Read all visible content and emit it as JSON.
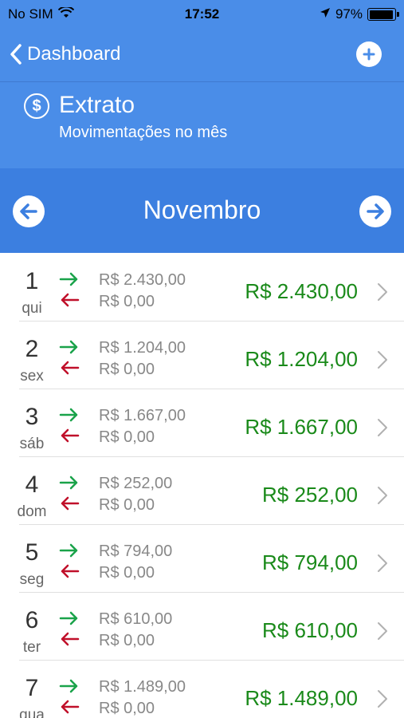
{
  "status_bar": {
    "carrier": "No SIM",
    "time": "17:52",
    "battery_percent": "97%",
    "battery_level": 0.97
  },
  "navbar": {
    "back_label": "Dashboard"
  },
  "header": {
    "title": "Extrato",
    "subtitle": "Movimentações no mês"
  },
  "month_selector": {
    "month": "Novembro"
  },
  "colors": {
    "header_blue": "#4a8de8",
    "month_bar_blue": "#3c7fe0",
    "income_green": "#1aa34a",
    "expense_red": "#c0102a",
    "total_green": "#1a8a1a"
  },
  "days": [
    {
      "day": "1",
      "weekday": "qui",
      "income": "R$ 2.430,00",
      "expense": "R$ 0,00",
      "total": "R$ 2.430,00"
    },
    {
      "day": "2",
      "weekday": "sex",
      "income": "R$ 1.204,00",
      "expense": "R$ 0,00",
      "total": "R$ 1.204,00"
    },
    {
      "day": "3",
      "weekday": "sáb",
      "income": "R$ 1.667,00",
      "expense": "R$ 0,00",
      "total": "R$ 1.667,00"
    },
    {
      "day": "4",
      "weekday": "dom",
      "income": "R$ 252,00",
      "expense": "R$ 0,00",
      "total": "R$ 252,00"
    },
    {
      "day": "5",
      "weekday": "seg",
      "income": "R$ 794,00",
      "expense": "R$ 0,00",
      "total": "R$ 794,00"
    },
    {
      "day": "6",
      "weekday": "ter",
      "income": "R$ 610,00",
      "expense": "R$ 0,00",
      "total": "R$ 610,00"
    },
    {
      "day": "7",
      "weekday": "qua",
      "income": "R$ 1.489,00",
      "expense": "R$ 0,00",
      "total": "R$ 1.489,00"
    }
  ]
}
